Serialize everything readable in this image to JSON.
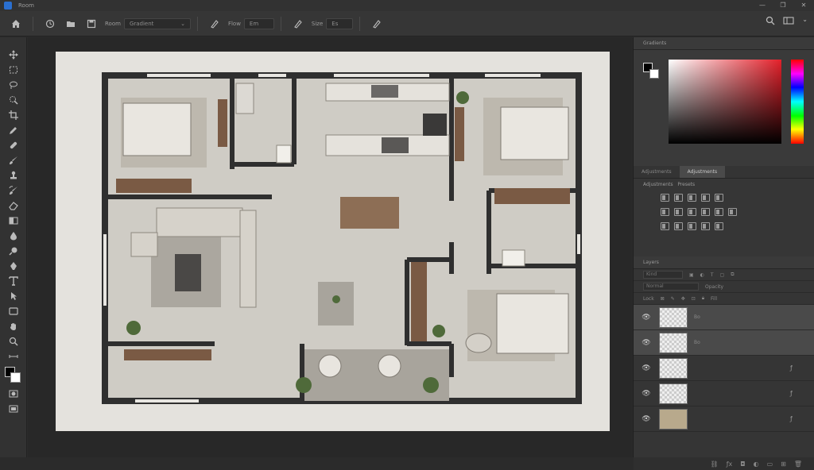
{
  "window": {
    "title": "Room",
    "controls": [
      "—",
      "❐",
      "✕"
    ]
  },
  "options_bar": {
    "mode_label": "Room",
    "mode_value": "Gradient",
    "flow_label": "Flow",
    "flow_value": "Em",
    "size_label": "Size",
    "size_value": "Es"
  },
  "color_panel": {
    "title": "Gradients",
    "accent": "#e4202a"
  },
  "adjustments": {
    "tabs": [
      "Adjustments",
      "Adjustments"
    ],
    "title": "Adjustments",
    "subtitle": "Presets"
  },
  "layers_panel": {
    "title": "Layers",
    "kind_filter": "Kind",
    "blend_mode": "Normal",
    "opacity_label": "Opacity",
    "lock_label": "Lock",
    "fill_label": "Fill",
    "layers": [
      {
        "name": "Bo",
        "selected": true,
        "kind": "transparent",
        "fx": ""
      },
      {
        "name": "Bo",
        "selected": true,
        "kind": "transparent",
        "fx": ""
      },
      {
        "name": "",
        "selected": false,
        "kind": "transparent",
        "fx": "ƒ"
      },
      {
        "name": "",
        "selected": false,
        "kind": "transparent",
        "fx": "ƒ"
      },
      {
        "name": "",
        "selected": false,
        "kind": "image",
        "fx": "ƒ"
      }
    ],
    "footer_icons": [
      "link-icon",
      "fx-icon",
      "mask-icon",
      "adjustment-icon",
      "folder-icon",
      "new-layer-icon",
      "trash-icon"
    ]
  },
  "tools": [
    "move-icon",
    "marquee-icon",
    "lasso-icon",
    "quick-select-icon",
    "crop-icon",
    "eyedropper-icon",
    "healing-icon",
    "brush-icon",
    "stamp-icon",
    "history-brush-icon",
    "eraser-icon",
    "gradient-icon",
    "blur-icon",
    "dodge-icon",
    "pen-icon",
    "type-icon",
    "path-select-icon",
    "shape-icon",
    "hand-icon",
    "zoom-icon",
    "more-icon"
  ],
  "colors": {
    "wall": "#2f2f2f",
    "floor": "#cfccc5",
    "wood": "#7a5a44",
    "paper": "#e4e2dd"
  }
}
